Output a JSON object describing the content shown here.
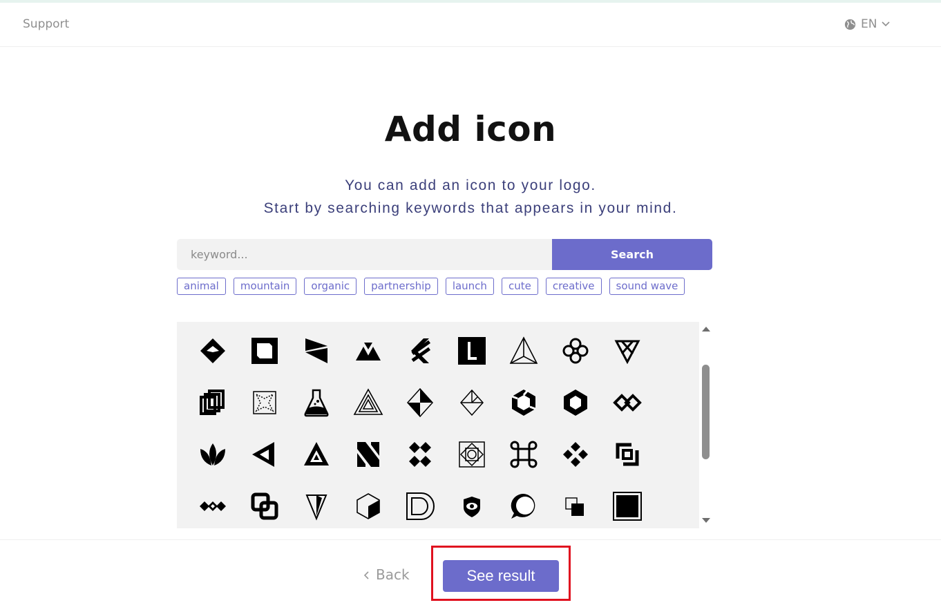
{
  "header": {
    "support_label": "Support",
    "language": "EN"
  },
  "page": {
    "title": "Add icon",
    "subtitle_line1": "You can add an icon to your logo.",
    "subtitle_line2": "Start by searching keywords that appears in your mind."
  },
  "search": {
    "placeholder": "keyword...",
    "value": "",
    "button_label": "Search"
  },
  "tags": [
    "animal",
    "mountain",
    "organic",
    "partnership",
    "launch",
    "cute",
    "creative",
    "sound wave"
  ],
  "icons": [
    "diamond-icon",
    "square-frame-icon",
    "flag-triangles-icon",
    "twin-triangles-icon",
    "zigzag-stripes-icon",
    "letter-l-block-icon",
    "line-pyramid-icon",
    "knot-flower-icon",
    "triangle-knot-icon",
    "linked-squares-icon",
    "dotted-square-icon",
    "flask-icon",
    "impossible-triangle-icon",
    "crystal-diamond-icon",
    "outline-diamond-icon",
    "spiral-hexagon-icon",
    "hexagon-ring-icon",
    "interlocked-diamonds-icon",
    "lotus-leaves-icon",
    "folded-triangle-icon",
    "nested-triangle-icon",
    "letter-n-icon",
    "four-diamonds-icon",
    "geometric-square-icon",
    "command-key-icon",
    "diamond-cluster-icon",
    "bracket-squares-icon",
    "chain-diamonds-icon",
    "overlap-squares-icon",
    "arrowhead-icon",
    "cube-icon",
    "letter-d-rings-icon",
    "eye-badge-icon",
    "speech-bubble-icon",
    "offset-squares-icon",
    "framed-square-icon"
  ],
  "footer": {
    "back_label": "Back",
    "see_result_label": "See result"
  }
}
